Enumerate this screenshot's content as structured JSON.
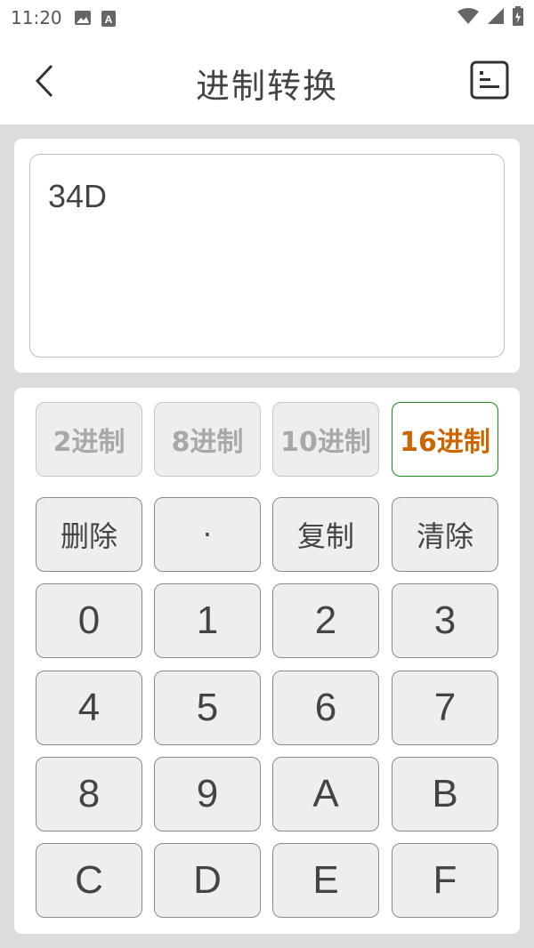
{
  "status_bar": {
    "time": "11:20",
    "icons_left": [
      "image-icon",
      "text-a-icon"
    ],
    "icons_right": [
      "wifi-icon",
      "signal-icon",
      "battery-icon"
    ]
  },
  "header": {
    "title": "进制转换",
    "back_icon": "chevron-left-icon",
    "history_icon": "history-icon"
  },
  "display": {
    "value": "34D"
  },
  "base_buttons": [
    {
      "label": "2进制",
      "active": false
    },
    {
      "label": "8进制",
      "active": false
    },
    {
      "label": "10进制",
      "active": false
    },
    {
      "label": "16进制",
      "active": true
    }
  ],
  "function_keys": {
    "delete": "删除",
    "dot": "·",
    "copy": "复制",
    "clear": "清除"
  },
  "digit_keys": [
    "0",
    "1",
    "2",
    "3",
    "4",
    "5",
    "6",
    "7",
    "8",
    "9",
    "A",
    "B",
    "C",
    "D",
    "E",
    "F"
  ],
  "colors": {
    "active_border": "#1a8a1a",
    "active_text": "#cc6600",
    "inactive_text": "#a8a8a8",
    "key_bg": "#eeeeee",
    "page_bg": "#dcdcdc"
  }
}
